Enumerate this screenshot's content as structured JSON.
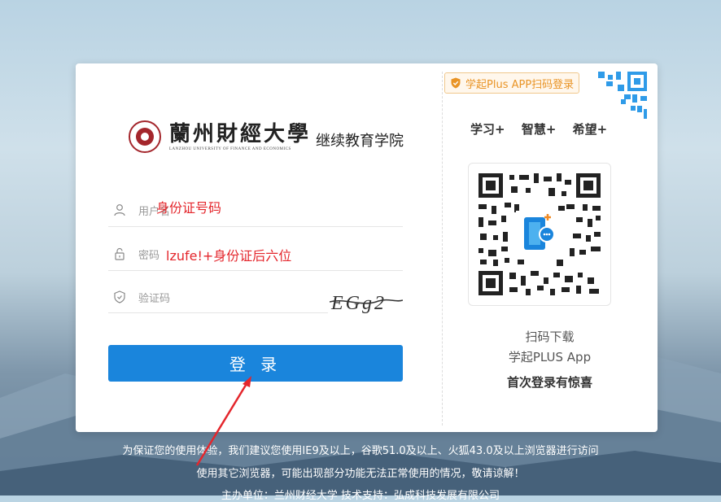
{
  "header": {
    "university_name": "蘭州財經大學",
    "university_english": "LANZHOU UNIVERSITY OF FINANCE AND ECONOMICS",
    "college_name": "继续教育学院"
  },
  "form": {
    "username": {
      "placeholder": "用户名",
      "overlay_hint": "身份证号码"
    },
    "password": {
      "placeholder": "密码",
      "overlay_hint": "lzufe!+身份证后六位"
    },
    "captcha": {
      "placeholder": "验证码",
      "image_text": "EGg2"
    },
    "login_label": "登 录"
  },
  "qr_panel": {
    "scan_badge": "学起Plus APP扫码登录",
    "tags": [
      "学习+",
      "智慧+",
      "希望+"
    ],
    "scan_download": "扫码下载",
    "app_name": "学起PLUS App",
    "first_login": "首次登录有惊喜"
  },
  "footer": {
    "line1": "为保证您的使用体验，我们建议您使用IE9及以上，谷歌51.0及以上、火狐43.0及以上浏览器进行访问",
    "line2": "使用其它浏览器，可能出现部分功能无法正常使用的情况，敬请谅解！",
    "line3": "主办单位：兰州财经大学  技术支持：弘成科技发展有限公司"
  },
  "colors": {
    "primary": "#1a85dc",
    "annotation": "#e4262c",
    "badge": "#e99426",
    "brand": "#a4262c"
  },
  "icons": [
    "user-icon",
    "lock-icon",
    "shield-icon",
    "shield-check-icon",
    "qr-code-icon"
  ]
}
